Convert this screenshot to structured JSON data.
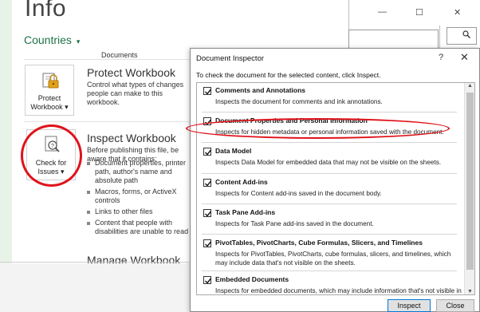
{
  "backstage": {
    "title": "Info",
    "file_name": "Countries",
    "file_caret": "▾",
    "documents_label": "Documents",
    "protect": {
      "button_label_line1": "Protect",
      "button_label_line2": "Workbook ▾",
      "title": "Protect Workbook",
      "description": "Control what types of changes people can make to this workbook."
    },
    "inspect": {
      "button_label_line1": "Check for",
      "button_label_line2": "Issues ▾",
      "title": "Inspect Workbook",
      "description": "Before publishing this file, be aware that it contains:",
      "bullets": [
        "Document properties, printer path, author's name and absolute path",
        "Macros, forms, or ActiveX controls",
        "Links to other files",
        "Content that people with disabilities are unable to read"
      ]
    },
    "manage_title": "Manage Workbook"
  },
  "window": {
    "minimize": "—",
    "restore": "☐",
    "close": "✕"
  },
  "dialog": {
    "title": "Document Inspector",
    "help": "?",
    "close": "✕",
    "instructions": "To check the document for the selected content, click Inspect.",
    "items": [
      {
        "title": "Comments and Annotations",
        "description": "Inspects the document for comments and ink annotations.",
        "checked": true
      },
      {
        "title": "Document Properties and Personal Information",
        "description": "Inspects for hidden metadata or personal information saved with the document.",
        "checked": true
      },
      {
        "title": "Data Model",
        "description": "Inspects Data Model for embedded data that may not be visible on the sheets.",
        "checked": true
      },
      {
        "title": "Content Add-ins",
        "description": "Inspects for Content add-ins saved in the document body.",
        "checked": true
      },
      {
        "title": "Task Pane Add-ins",
        "description": "Inspects for Task Pane add-ins saved in the document.",
        "checked": true
      },
      {
        "title": "PivotTables, PivotCharts, Cube Formulas, Slicers, and Timelines",
        "description": "Inspects for PivotTables, PivotCharts, cube formulas, slicers, and timelines, which may include data that's not visible on the sheets.",
        "checked": true
      },
      {
        "title": "Embedded Documents",
        "description": "Inspects for embedded documents, which may include information that's not visible in the file.",
        "checked": true
      }
    ],
    "inspect_button": "Inspect",
    "close_button": "Close"
  },
  "colors": {
    "excel_green": "#217346",
    "highlight_red": "#e0121a",
    "default_button_border": "#0078d7"
  },
  "icons": [
    "lock-icon",
    "document-search-icon",
    "checkbox-icon",
    "search-icon"
  ]
}
